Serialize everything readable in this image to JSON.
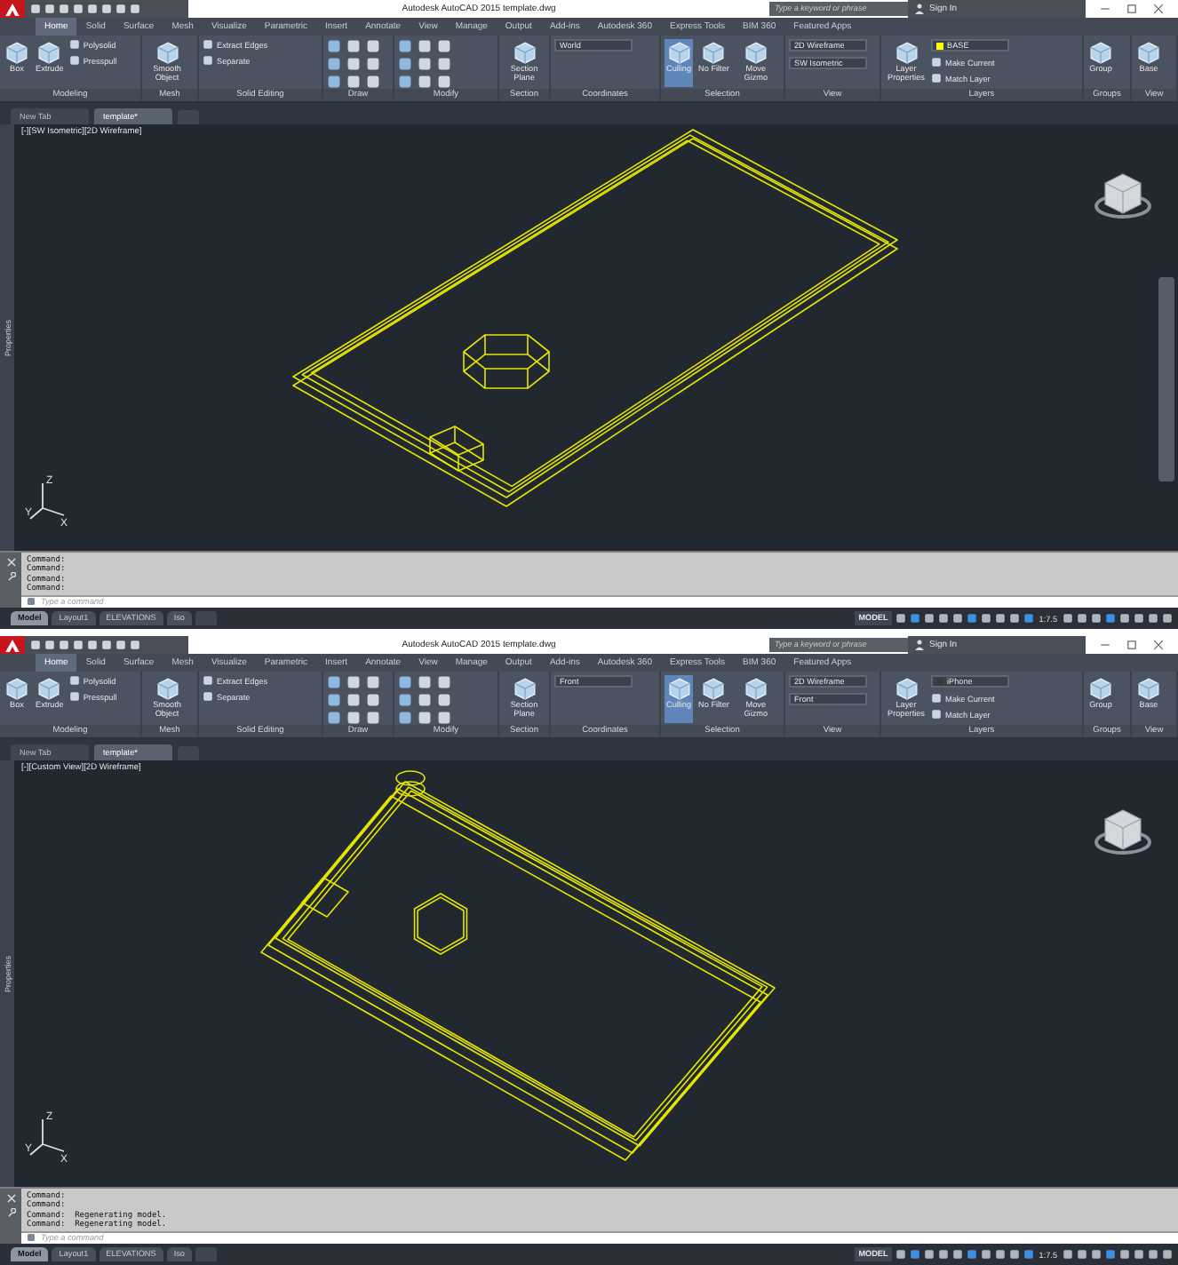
{
  "windows": [
    {
      "title_bar": {
        "app": "Autodesk AutoCAD 2015",
        "file": "template.dwg",
        "search_placeholder": "Type a keyword or phrase",
        "sign_in": "Sign In"
      },
      "ribbon_tabs": [
        {
          "label": "Home",
          "selected": true
        },
        {
          "label": "Solid",
          "selected": false
        },
        {
          "label": "Surface",
          "selected": false
        },
        {
          "label": "Mesh",
          "selected": false
        },
        {
          "label": "Visualize",
          "selected": false
        },
        {
          "label": "Parametric",
          "selected": false
        },
        {
          "label": "Insert",
          "selected": false
        },
        {
          "label": "Annotate",
          "selected": false
        },
        {
          "label": "View",
          "selected": false
        },
        {
          "label": "Manage",
          "selected": false
        },
        {
          "label": "Output",
          "selected": false
        },
        {
          "label": "Add-ins",
          "selected": false
        },
        {
          "label": "Autodesk 360",
          "selected": false
        },
        {
          "label": "Express Tools",
          "selected": false
        },
        {
          "label": "BIM 360",
          "selected": false
        },
        {
          "label": "Featured Apps",
          "selected": false
        }
      ],
      "ribbon_panels": [
        {
          "title": "Modeling",
          "items": [
            {
              "kind": "large",
              "label": "Box"
            },
            {
              "kind": "large",
              "label": "Extrude"
            },
            {
              "kind": "small",
              "label": "Polysolid"
            },
            {
              "kind": "small",
              "label": "Presspull"
            }
          ]
        },
        {
          "title": "Mesh",
          "items": [
            {
              "kind": "large",
              "label": "Smooth Object"
            }
          ]
        },
        {
          "title": "Solid Editing",
          "items": [
            {
              "kind": "small",
              "label": "Extract Edges"
            },
            {
              "kind": "small",
              "label": "Separate"
            }
          ]
        },
        {
          "title": "Draw"
        },
        {
          "title": "Modify"
        },
        {
          "title": "Section",
          "items": [
            {
              "kind": "large",
              "label": "Section Plane"
            }
          ]
        },
        {
          "title": "Coordinates",
          "items": [
            {
              "kind": "combo",
              "label": "World"
            }
          ]
        },
        {
          "title": "Selection",
          "items": [
            {
              "kind": "large",
              "label": "Culling",
              "on": true
            },
            {
              "kind": "large",
              "label": "No Filter",
              "on": false
            },
            {
              "kind": "large",
              "label": "Move Gizmo",
              "on": false
            }
          ]
        },
        {
          "title": "View",
          "items": [
            {
              "kind": "combo",
              "label": "2D Wireframe"
            },
            {
              "kind": "combo",
              "label": "SW Isometric"
            }
          ]
        },
        {
          "title": "Layers",
          "items": [
            {
              "kind": "large",
              "label": "Layer Properties"
            },
            {
              "kind": "layer",
              "label": "BASE",
              "color": "#ffff00"
            },
            {
              "kind": "small",
              "label": "Make Current"
            },
            {
              "kind": "small",
              "label": "Match Layer"
            }
          ]
        },
        {
          "title": "Groups",
          "items": [
            {
              "kind": "large",
              "label": "Group"
            }
          ]
        },
        {
          "title": "View",
          "items": [
            {
              "kind": "large",
              "label": "Base"
            }
          ]
        }
      ],
      "doc_tabs": [
        {
          "label": "New Tab",
          "selected": false
        },
        {
          "label": "template*",
          "selected": true
        }
      ],
      "viewport": {
        "label": "[-][SW Isometric][2D Wireframe]",
        "kind": "iso",
        "palette": "Properties",
        "ucs_labels": [
          "Z",
          "Y",
          "X"
        ]
      },
      "command_lines": [
        "Command:",
        "Command:",
        "Command:",
        "Command:"
      ],
      "command_placeholder": "Type a command",
      "layout_tabs": [
        {
          "label": "Model",
          "selected": true
        },
        {
          "label": "Layout1",
          "selected": false
        },
        {
          "label": "ELEVATIONS",
          "selected": false
        },
        {
          "label": "Iso",
          "selected": false
        }
      ],
      "status": {
        "space": "MODEL",
        "scale": "1:7.5"
      }
    },
    {
      "title_bar": {
        "app": "Autodesk AutoCAD 2015",
        "file": "template.dwg",
        "search_placeholder": "Type a keyword or phrase",
        "sign_in": "Sign In"
      },
      "ribbon_tabs": [
        {
          "label": "Home",
          "selected": true
        },
        {
          "label": "Solid",
          "selected": false
        },
        {
          "label": "Surface",
          "selected": false
        },
        {
          "label": "Mesh",
          "selected": false
        },
        {
          "label": "Visualize",
          "selected": false
        },
        {
          "label": "Parametric",
          "selected": false
        },
        {
          "label": "Insert",
          "selected": false
        },
        {
          "label": "Annotate",
          "selected": false
        },
        {
          "label": "View",
          "selected": false
        },
        {
          "label": "Manage",
          "selected": false
        },
        {
          "label": "Output",
          "selected": false
        },
        {
          "label": "Add-ins",
          "selected": false
        },
        {
          "label": "Autodesk 360",
          "selected": false
        },
        {
          "label": "Express Tools",
          "selected": false
        },
        {
          "label": "BIM 360",
          "selected": false
        },
        {
          "label": "Featured Apps",
          "selected": false
        }
      ],
      "ribbon_panels": [
        {
          "title": "Modeling",
          "items": [
            {
              "kind": "large",
              "label": "Box"
            },
            {
              "kind": "large",
              "label": "Extrude"
            },
            {
              "kind": "small",
              "label": "Polysolid"
            },
            {
              "kind": "small",
              "label": "Presspull"
            }
          ]
        },
        {
          "title": "Mesh",
          "items": [
            {
              "kind": "large",
              "label": "Smooth Object"
            }
          ]
        },
        {
          "title": "Solid Editing",
          "items": [
            {
              "kind": "small",
              "label": "Extract Edges"
            },
            {
              "kind": "small",
              "label": "Separate"
            }
          ]
        },
        {
          "title": "Draw"
        },
        {
          "title": "Modify"
        },
        {
          "title": "Section",
          "items": [
            {
              "kind": "large",
              "label": "Section Plane"
            }
          ]
        },
        {
          "title": "Coordinates",
          "items": [
            {
              "kind": "combo",
              "label": "Front"
            }
          ]
        },
        {
          "title": "Selection",
          "items": [
            {
              "kind": "large",
              "label": "Culling",
              "on": true
            },
            {
              "kind": "large",
              "label": "No Filter",
              "on": false
            },
            {
              "kind": "large",
              "label": "Move Gizmo",
              "on": false
            }
          ]
        },
        {
          "title": "View",
          "items": [
            {
              "kind": "combo",
              "label": "2D Wireframe"
            },
            {
              "kind": "combo",
              "label": "Front"
            }
          ]
        },
        {
          "title": "Layers",
          "items": [
            {
              "kind": "large",
              "label": "Layer Properties"
            },
            {
              "kind": "layer",
              "label": "iPhone",
              "color": "#3a3a3a"
            },
            {
              "kind": "small",
              "label": "Make Current"
            },
            {
              "kind": "small",
              "label": "Match Layer"
            }
          ]
        },
        {
          "title": "Groups",
          "items": [
            {
              "kind": "large",
              "label": "Group"
            }
          ]
        },
        {
          "title": "View",
          "items": [
            {
              "kind": "large",
              "label": "Base"
            }
          ]
        }
      ],
      "doc_tabs": [
        {
          "label": "New Tab",
          "selected": false
        },
        {
          "label": "template*",
          "selected": true
        }
      ],
      "viewport": {
        "label": "[-][Custom View][2D Wireframe]",
        "kind": "custom",
        "palette": "Properties",
        "ucs_labels": [
          "Z",
          "Y",
          "X"
        ]
      },
      "command_lines": [
        "Command:",
        "Command:",
        "Command:  Regenerating model.",
        "Command:  Regenerating model."
      ],
      "command_placeholder": "Type a command",
      "layout_tabs": [
        {
          "label": "Model",
          "selected": true
        },
        {
          "label": "Layout1",
          "selected": false
        },
        {
          "label": "ELEVATIONS",
          "selected": false
        },
        {
          "label": "Iso",
          "selected": false
        }
      ],
      "status": {
        "space": "MODEL",
        "scale": "1:7.5"
      }
    }
  ]
}
